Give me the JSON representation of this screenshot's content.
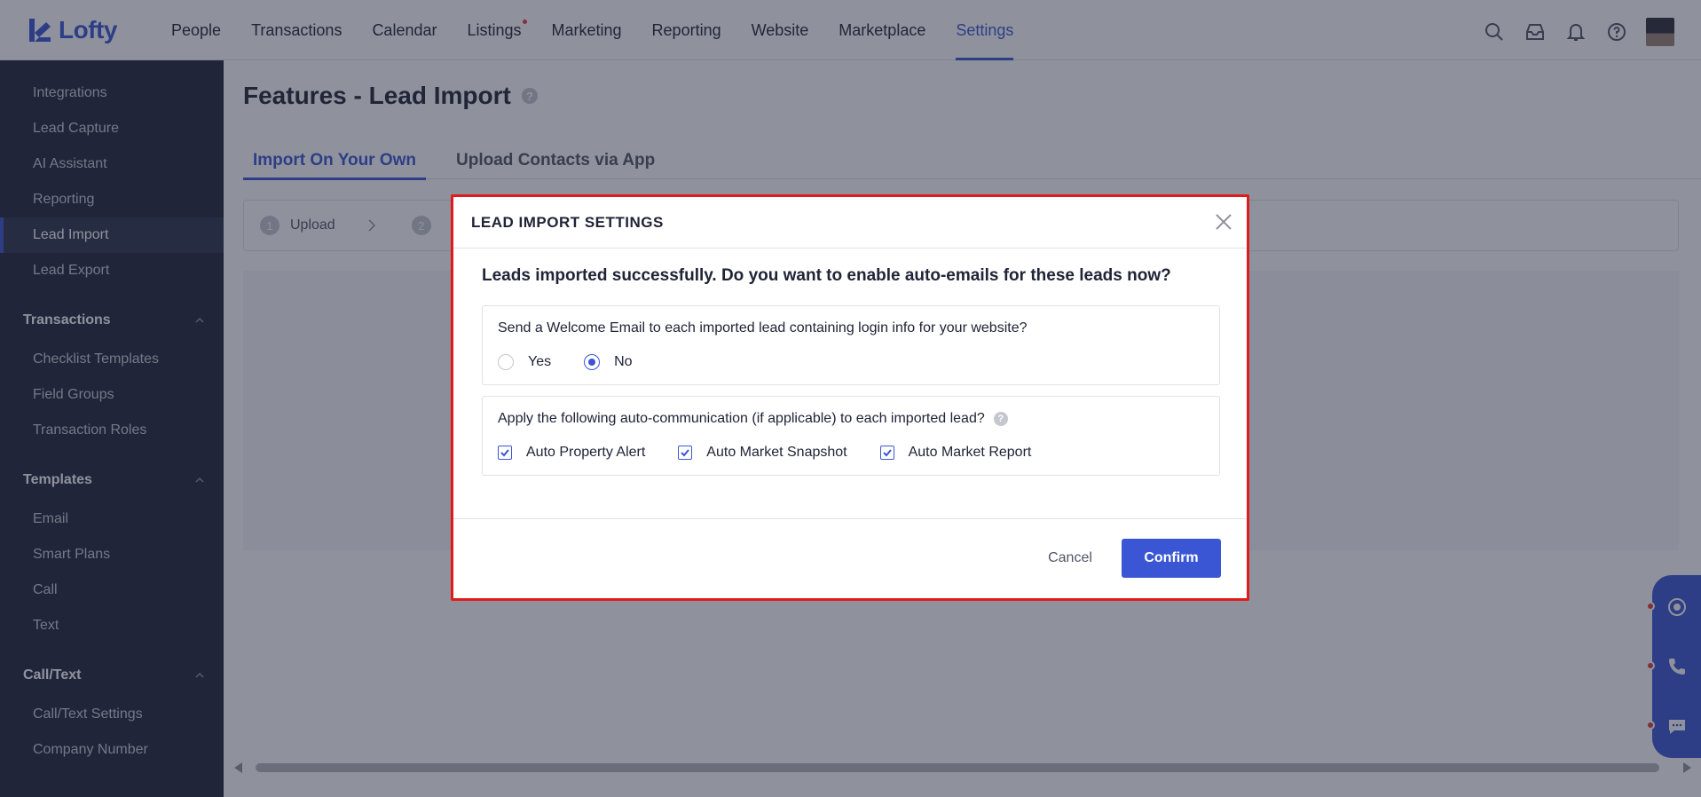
{
  "app": {
    "logo_text": "Lofty"
  },
  "nav": {
    "items": [
      {
        "label": "People"
      },
      {
        "label": "Transactions"
      },
      {
        "label": "Calendar"
      },
      {
        "label": "Listings"
      },
      {
        "label": "Marketing"
      },
      {
        "label": "Reporting"
      },
      {
        "label": "Website"
      },
      {
        "label": "Marketplace"
      },
      {
        "label": "Settings"
      }
    ],
    "active": "Settings"
  },
  "sidebar": {
    "items": [
      {
        "label": "Integrations"
      },
      {
        "label": "Lead Capture"
      },
      {
        "label": "AI Assistant"
      },
      {
        "label": "Reporting"
      },
      {
        "label": "Lead Import"
      },
      {
        "label": "Lead Export"
      }
    ],
    "groups": [
      {
        "label": "Transactions",
        "items": [
          {
            "label": "Checklist Templates"
          },
          {
            "label": "Field Groups"
          },
          {
            "label": "Transaction Roles"
          }
        ]
      },
      {
        "label": "Templates",
        "items": [
          {
            "label": "Email"
          },
          {
            "label": "Smart Plans"
          },
          {
            "label": "Call"
          },
          {
            "label": "Text"
          }
        ]
      },
      {
        "label": "Call/Text",
        "items": [
          {
            "label": "Call/Text Settings"
          },
          {
            "label": "Company Number"
          }
        ]
      }
    ]
  },
  "page": {
    "title": "Features - Lead Import",
    "tabs": [
      {
        "label": "Import On Your Own"
      },
      {
        "label": "Upload Contacts via App"
      }
    ],
    "steps": [
      {
        "num": "1",
        "label": "Upload"
      },
      {
        "num": "2",
        "label": ""
      }
    ]
  },
  "modal": {
    "title": "LEAD IMPORT SETTINGS",
    "question": "Leads imported successfully. Do you want to enable auto-emails for these leads now?",
    "welcome": {
      "text": "Send a Welcome Email to each imported lead containing login info for your website?",
      "options": [
        {
          "label": "Yes"
        },
        {
          "label": "No"
        }
      ],
      "selected": "No"
    },
    "auto": {
      "text": "Apply the following auto-communication (if applicable) to each imported lead?",
      "options": [
        {
          "label": "Auto Property Alert",
          "checked": true
        },
        {
          "label": "Auto Market Snapshot",
          "checked": true
        },
        {
          "label": "Auto Market Report",
          "checked": true
        }
      ]
    },
    "cancel_label": "Cancel",
    "confirm_label": "Confirm"
  },
  "colors": {
    "primary": "#3a56d4",
    "sidebar": "#20253a",
    "highlight": "#e01b1b",
    "notification": "#e03a3a"
  }
}
